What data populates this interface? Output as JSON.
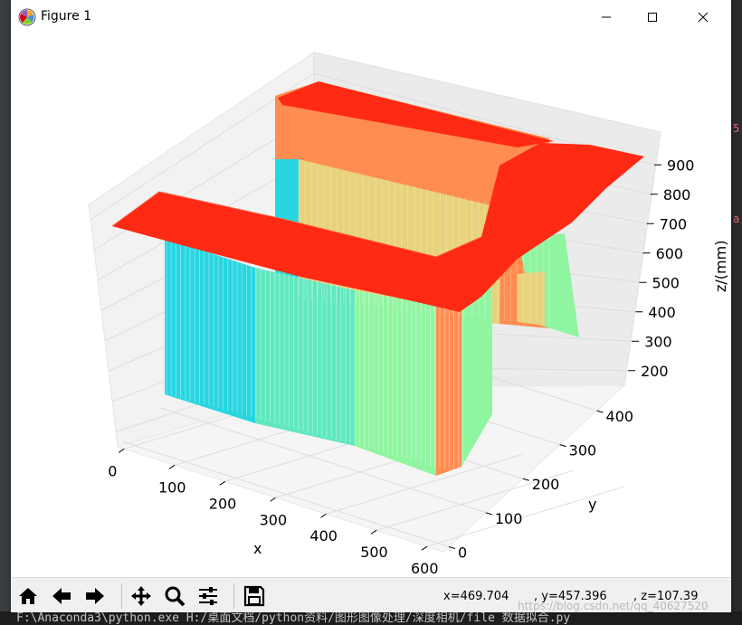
{
  "window": {
    "title": "Figure 1"
  },
  "chart_data": {
    "type": "surface-3d",
    "zlabel": "z/(mm)",
    "xlabel": "x",
    "ylabel": "y",
    "x_ticks": [
      "0",
      "100",
      "200",
      "300",
      "400",
      "500",
      "600"
    ],
    "y_ticks": [
      "0",
      "100",
      "200",
      "300",
      "400"
    ],
    "z_ticks": [
      "200",
      "300",
      "400",
      "500",
      "600",
      "700",
      "800",
      "900"
    ],
    "xlim": [
      0,
      600
    ],
    "ylim": [
      0,
      450
    ],
    "zlim": [
      150,
      950
    ],
    "grid": true,
    "colormap": "rainbow",
    "colors": {
      "top_surface": "#ff2a14",
      "wall_orange": "#ff8c50",
      "wall_yellow": "#e8d27c",
      "wall_green": "#90f5a0",
      "wall_cyan": "#28d6e0",
      "wall_blue": "#5d6bd8"
    }
  },
  "toolbar": {
    "home_icon": "home-icon",
    "back_icon": "arrow-left-icon",
    "forward_icon": "arrow-right-icon",
    "pan_icon": "move-icon",
    "zoom_icon": "magnifier-icon",
    "configure_icon": "sliders-icon",
    "save_icon": "floppy-disk-icon"
  },
  "status": {
    "x": "x=469.704",
    "y": ", y=457.396",
    "z": ", z=107.39"
  },
  "background": {
    "console_line": "F:\\Anaconda3\\python.exe H:/桌面文档/python资料/图形图像处理/深度相机/file 数据拟合.py",
    "watermark": "https://blog.csdn.net/qq_40627520"
  }
}
